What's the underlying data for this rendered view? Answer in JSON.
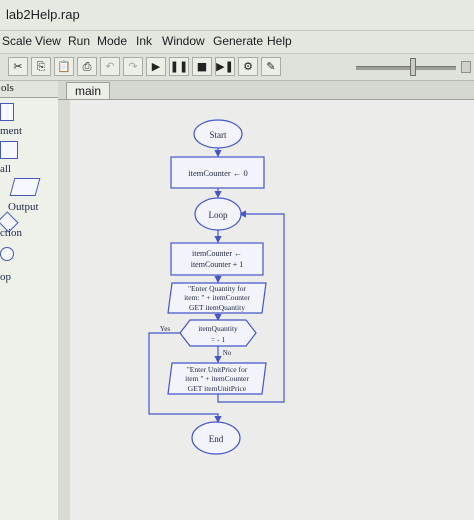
{
  "window": {
    "title": "lab2Help.rap"
  },
  "menu": [
    "Scale",
    "View",
    "Run",
    "Mode",
    "Ink",
    "Window",
    "Generate",
    "Help"
  ],
  "toolbar": {
    "buttons": [
      {
        "name": "cut",
        "glyph": "✂"
      },
      {
        "name": "copy",
        "glyph": "⎘"
      },
      {
        "name": "paste",
        "glyph": "📋"
      },
      {
        "name": "print",
        "glyph": "⎙"
      },
      {
        "name": "undo",
        "glyph": "↶"
      },
      {
        "name": "redo",
        "glyph": "↷"
      },
      {
        "name": "run",
        "glyph": "▶"
      },
      {
        "name": "pause",
        "glyph": "❚❚"
      },
      {
        "name": "stop",
        "glyph": "■"
      },
      {
        "name": "step",
        "glyph": "▶❚"
      },
      {
        "name": "tool-1",
        "glyph": "⚙"
      },
      {
        "name": "pen",
        "glyph": "✎"
      }
    ]
  },
  "left_panel": {
    "header": "ols",
    "labels": [
      "ment",
      "all",
      "Output",
      "ction",
      "op"
    ]
  },
  "tabs": {
    "active": "main"
  },
  "flowchart": {
    "start": "Start",
    "assign1": "itemCounter ← 0",
    "loop": "Loop",
    "assign2_line1": "itemCounter ←",
    "assign2_line2": "itemCounter + 1",
    "input1_line1": "\"Enter Quantity for",
    "input1_line2": "item: \" + itemCounter",
    "input1_line3": "GET itemQuantity",
    "decision_line1": "itemQuantity",
    "decision_line2": "= - 1",
    "yes": "Yes",
    "no": "No",
    "input2_line1": "\"Enter UnitPrice for",
    "input2_line2": "item \" + itemCounter",
    "input2_line3": "GET itemUnitPrice",
    "end": "End"
  },
  "colors": {
    "flow_stroke": "#4656c8",
    "flow_text": "#1b2440"
  }
}
